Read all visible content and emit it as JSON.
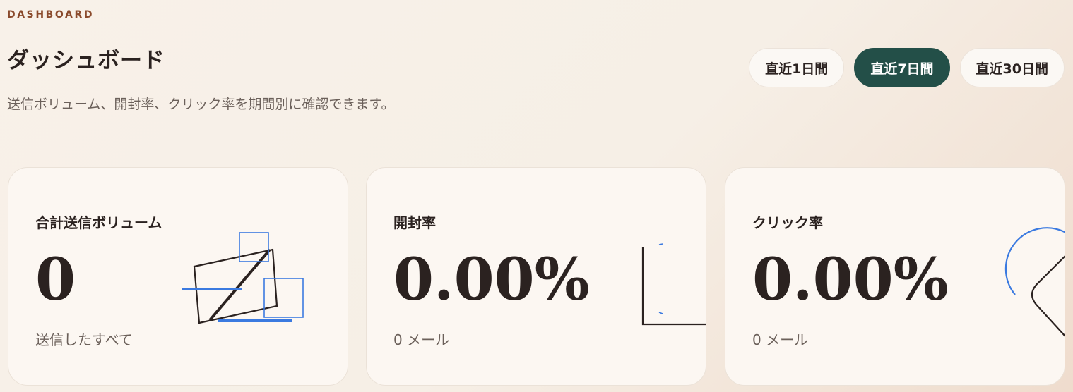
{
  "header": {
    "eyebrow": "DASHBOARD",
    "title": "ダッシュボード",
    "subtitle": "送信ボリューム、開封率、クリック率を期間別に確認できます。"
  },
  "range_selector": {
    "options": [
      "直近1日間",
      "直近7日間",
      "直近30日間"
    ],
    "selected": "直近7日間"
  },
  "cards": [
    {
      "label": "合計送信ボリューム",
      "value": "0",
      "caption": "送信したすべて",
      "illustration": "envelope-illustration"
    },
    {
      "label": "開封率",
      "value": "0.00%",
      "caption": "0 メール",
      "illustration": "open-illustration"
    },
    {
      "label": "クリック率",
      "value": "0.00%",
      "caption": "0 メール",
      "illustration": "click-illustration"
    }
  ],
  "colors": {
    "accent": "#234f48",
    "eyebrow": "#8a4a2c",
    "illustration_blue": "#3b7ae0",
    "ink": "#2b2220"
  }
}
